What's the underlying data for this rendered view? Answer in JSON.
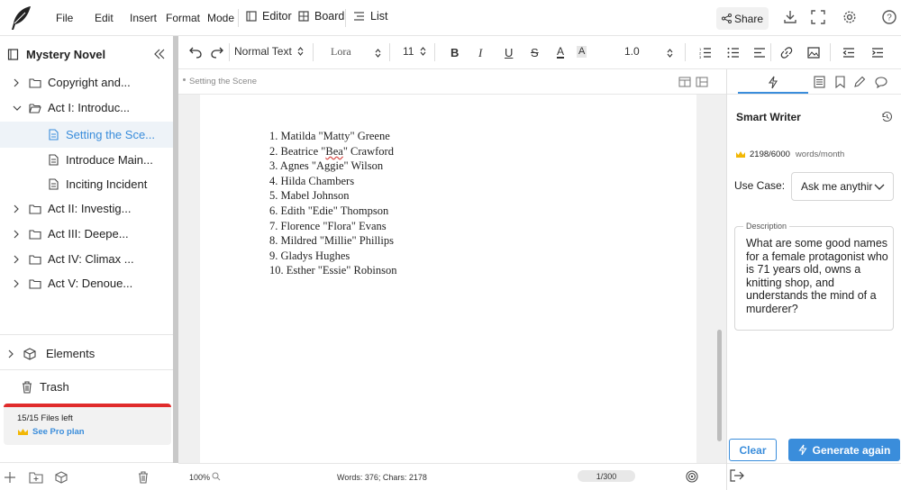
{
  "menu": {
    "file": "File",
    "edit": "Edit",
    "insert": "Insert",
    "format": "Format",
    "mode": "Mode"
  },
  "modes": {
    "editor": "Editor",
    "board": "Board",
    "list": "List"
  },
  "share_label": "Share",
  "sidebar": {
    "title": "Mystery Novel",
    "items": [
      {
        "label": "Copyright and..."
      },
      {
        "label": "Act I: Introduc..."
      },
      {
        "label": "Setting the Sce..."
      },
      {
        "label": "Introduce Main..."
      },
      {
        "label": "Inciting Incident"
      },
      {
        "label": "Act II: Investig..."
      },
      {
        "label": "Act III: Deepe..."
      },
      {
        "label": "Act IV: Climax ..."
      },
      {
        "label": "Act V: Denoue..."
      }
    ],
    "elements_label": "Elements",
    "trash_label": "Trash",
    "files_left": "15/15 Files left",
    "pro_link": "See Pro plan"
  },
  "toolbar": {
    "style": "Normal Text",
    "font": "Lora",
    "size": "11",
    "line_spacing": "1.0"
  },
  "breadcrumb": "Setting the Scene",
  "document": {
    "items": [
      "1. Matilda \"Matty\" Greene",
      "2. Beatrice \"Bea\" Crawford",
      "3. Agnes \"Aggie\" Wilson",
      "4. Hilda Chambers",
      "5. Mabel Johnson",
      "6. Edith \"Edie\" Thompson",
      "7. Florence \"Flora\" Evans",
      "8. Mildred \"Millie\" Phillips",
      "9. Gladys Hughes",
      "10. Esther \"Essie\" Robinson"
    ]
  },
  "status": {
    "zoom": "100%",
    "counts": "Words: 376; Chars: 2178",
    "page": "1/300"
  },
  "panel": {
    "title": "Smart Writer",
    "usage": "2198/6000",
    "usage_unit": "words/month",
    "use_case_label": "Use Case:",
    "use_case_value": "Ask me anythir",
    "description_label": "Description",
    "description": "What are some good names for a female protagonist who is 71 years old, owns a knitting shop, and understands the mind of a murderer?",
    "clear_label": "Clear",
    "generate_label": "Generate again"
  },
  "colors": {
    "accent": "#3a8ddb",
    "red_bar": "#e02b2b",
    "crown": "#f2b705"
  }
}
